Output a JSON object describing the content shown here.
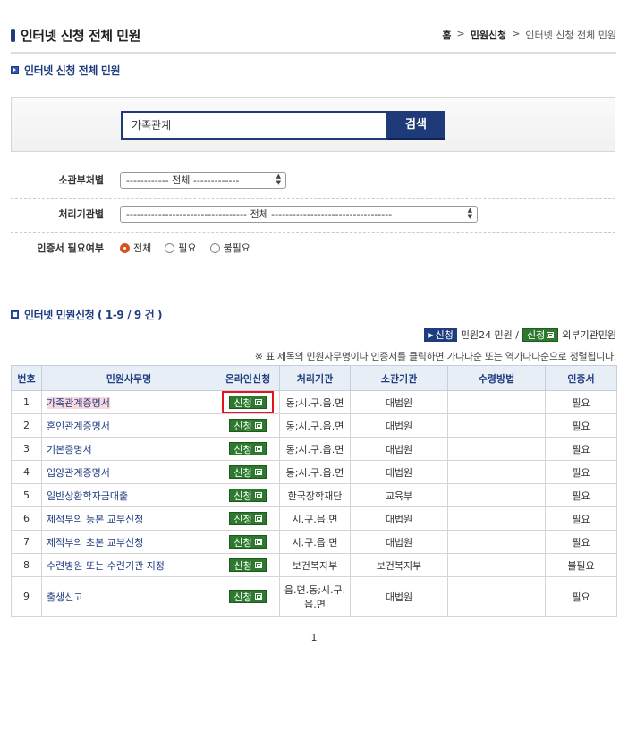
{
  "page": {
    "title": "인터넷 신청 전체 민원",
    "breadcrumb": {
      "home": "홈",
      "sep1": ">",
      "parent": "민원신청",
      "sep2": ">",
      "current": "인터넷 신청 전체 민원"
    }
  },
  "section1": {
    "title": "인터넷 신청 전체 민원"
  },
  "search": {
    "value": "가족관계",
    "button_label": "검색"
  },
  "filters": {
    "dept_label": "소관부처별",
    "dept_value": "------------ 전체 -------------",
    "agency_label": "처리기관별",
    "agency_value": "---------------------------------- 전체 ----------------------------------",
    "cert_label": "인증서 필요여부",
    "cert_options": [
      "전체",
      "필요",
      "불필요"
    ],
    "cert_selected": "전체"
  },
  "section2": {
    "title": "인터넷 민원신청 ( 1-9 / 9 건 )"
  },
  "legend": {
    "blue_tag": "신청",
    "blue_text": "민원24 민원 /",
    "green_tag": "신청",
    "green_text": "외부기관민원"
  },
  "note": "※ 표 제목의 민원사무명이나 인증서를 클릭하면 가나다순 또는 역가나다순으로 정렬됩니다.",
  "table": {
    "headers": [
      "번호",
      "민원사무명",
      "온라인신청",
      "처리기관",
      "소관기관",
      "수령방법",
      "인증서"
    ],
    "apply_label": "신청",
    "rows": [
      {
        "no": "1",
        "name": "가족관계증명서",
        "agency": "동;시.구.읍.면",
        "owner": "대법원",
        "receive": "",
        "cert": "필요"
      },
      {
        "no": "2",
        "name": "혼인관계증명서",
        "agency": "동;시.구.읍.면",
        "owner": "대법원",
        "receive": "",
        "cert": "필요"
      },
      {
        "no": "3",
        "name": "기본증명서",
        "agency": "동;시.구.읍.면",
        "owner": "대법원",
        "receive": "",
        "cert": "필요"
      },
      {
        "no": "4",
        "name": "입양관계증명서",
        "agency": "동;시.구.읍.면",
        "owner": "대법원",
        "receive": "",
        "cert": "필요"
      },
      {
        "no": "5",
        "name": "일반상환학자금대출",
        "agency": "한국장학재단",
        "owner": "교육부",
        "receive": "",
        "cert": "필요"
      },
      {
        "no": "6",
        "name": "제적부의 등본 교부신청",
        "agency": "시.구.읍.면",
        "owner": "대법원",
        "receive": "",
        "cert": "필요"
      },
      {
        "no": "7",
        "name": "제적부의 초본 교부신청",
        "agency": "시.구.읍.면",
        "owner": "대법원",
        "receive": "",
        "cert": "필요"
      },
      {
        "no": "8",
        "name": "수련병원 또는 수련기관 지정",
        "agency": "보건복지부",
        "owner": "보건복지부",
        "receive": "",
        "cert": "불필요"
      },
      {
        "no": "9",
        "name": "출생신고",
        "agency": "읍.면.동;시.구.읍.면",
        "owner": "대법원",
        "receive": "",
        "cert": "필요"
      }
    ]
  },
  "pager": {
    "current": "1"
  }
}
